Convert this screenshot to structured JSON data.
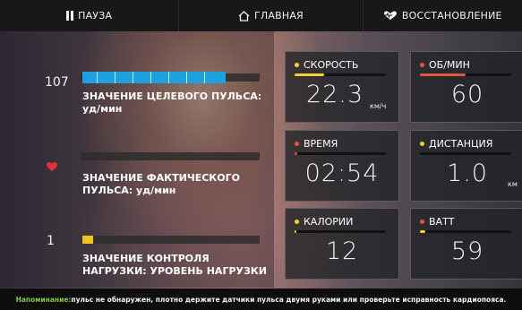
{
  "topbar": {
    "pause_label": "ПАУЗА",
    "home_label": "ГЛАВНАЯ",
    "recovery_label": "ВОССТАНОВЛЕНИЕ"
  },
  "left": {
    "target_hr": {
      "value": "107",
      "title": "ЗНАЧЕНИЕ ЦЕЛЕВОГО ПУЛЬСА: уд/мин",
      "bar_color": "#1fa1e0"
    },
    "actual_hr": {
      "title": "ЗНАЧЕНИЕ ФАКТИЧЕСКОГО ПУЛЬСА: уд/мин",
      "icon": "heart-icon",
      "icon_color": "#e0323a"
    },
    "load": {
      "value": "1",
      "title": "ЗНАЧЕНИЕ КОНТРОЛЯ НАГРУЗКИ: УРОВЕНЬ НАГРУЗКИ",
      "bar_color": "#f0c128"
    }
  },
  "panels": {
    "speed": {
      "label": "СКОРОСТЬ",
      "value": "22.3",
      "unit": "км/ч",
      "color": "#f3d22c",
      "fill": 0.32
    },
    "rpm": {
      "label": "ОБ/МИН",
      "value": "60",
      "unit": "",
      "color": "#e2583a",
      "fill": 0.5
    },
    "time": {
      "label": "ВРЕМЯ",
      "value": "02:54",
      "unit": "",
      "color": "#e2583a",
      "fill": 0.0
    },
    "distance": {
      "label": "ДИСТАНЦИЯ",
      "value": "1.0",
      "unit": "км",
      "color": "#f3d22c",
      "fill": 0.0
    },
    "calories": {
      "label": "КАЛОРИИ",
      "value": "12",
      "unit": "",
      "color": "#f3d22c",
      "fill": 0.02
    },
    "watt": {
      "label": "ВАТТ",
      "value": "59",
      "unit": "",
      "color": "#e2583a",
      "fill": 0.06
    }
  },
  "footer": {
    "highlight": "Напоминание:",
    "text": "пульс не обнаружен, плотно держите датчики пульса двумя руками или проверьте исправность кардиопояса."
  }
}
